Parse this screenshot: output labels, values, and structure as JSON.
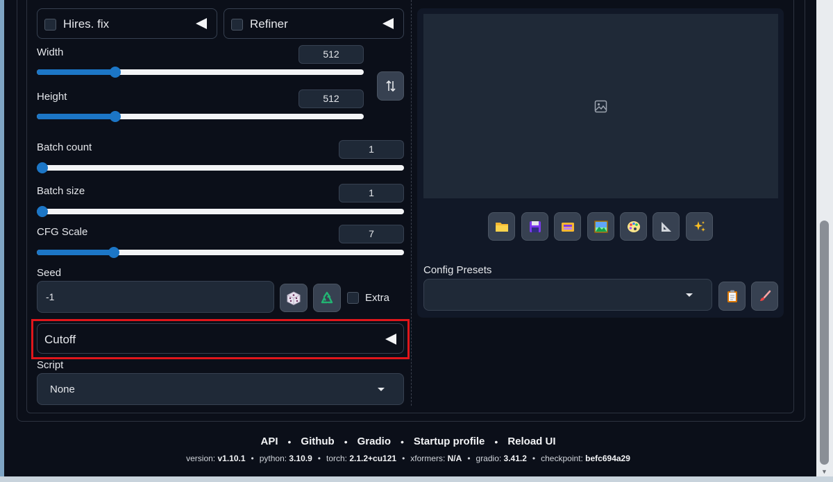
{
  "accordions": {
    "hires_fix": "Hires. fix",
    "refiner": "Refiner",
    "cutoff": "Cutoff"
  },
  "sliders": {
    "width": {
      "label": "Width",
      "value": "512",
      "fraction": 0.23
    },
    "height": {
      "label": "Height",
      "value": "512",
      "fraction": 0.23
    },
    "batch_count": {
      "label": "Batch count",
      "value": "1",
      "fraction": 0.0
    },
    "batch_size": {
      "label": "Batch size",
      "value": "1",
      "fraction": 0.0
    },
    "cfg_scale": {
      "label": "CFG Scale",
      "value": "7",
      "fraction": 0.2
    }
  },
  "seed": {
    "label": "Seed",
    "value": "-1",
    "extra_label": "Extra"
  },
  "script": {
    "label": "Script",
    "value": "None"
  },
  "config_presets": {
    "label": "Config Presets",
    "value": ""
  },
  "footer": {
    "links": [
      "API",
      "Github",
      "Gradio",
      "Startup profile",
      "Reload UI"
    ],
    "versions": [
      {
        "k": "version:",
        "v": "v1.10.1"
      },
      {
        "k": "python:",
        "v": "3.10.9"
      },
      {
        "k": "torch:",
        "v": "2.1.2+cu121"
      },
      {
        "k": "xformers:",
        "v": "N/A"
      },
      {
        "k": "gradio:",
        "v": "3.41.2"
      },
      {
        "k": "checkpoint:",
        "v": "befc694a29"
      }
    ]
  },
  "colors": {
    "accent": "#1c76c6",
    "highlight": "#e0161b",
    "background": "#0b0f19"
  },
  "icons": {
    "swap": "swap-dimensions-icon",
    "dice": "dice-icon",
    "recycle": "recycle-icon",
    "image_placeholder": "image-icon",
    "gallery": [
      "folder-icon",
      "save-icon",
      "zip-icon",
      "image-icon",
      "palette-icon",
      "triangle-ruler-icon",
      "sparkles-icon"
    ],
    "preset_buttons": [
      "clipboard-icon",
      "paintbrush-icon"
    ]
  }
}
